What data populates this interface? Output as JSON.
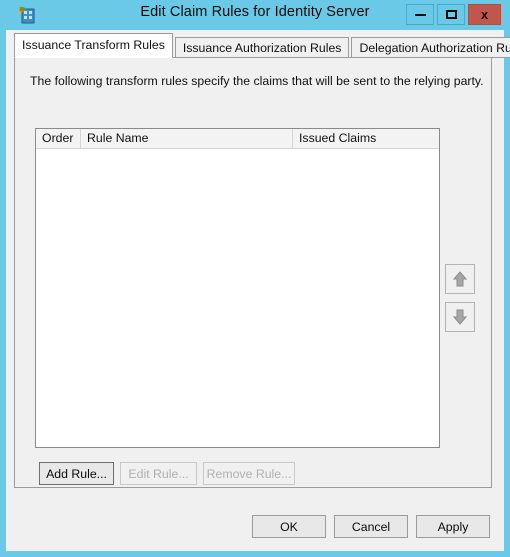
{
  "window": {
    "title": "Edit Claim Rules for Identity Server",
    "icon": "server-app-icon",
    "frame_color": "#6BC9E8",
    "close_color": "#C1564B",
    "controls": {
      "minimize_label": "—",
      "maximize_label": "□",
      "close_label": "x"
    }
  },
  "tabs": [
    {
      "label": "Issuance Transform Rules",
      "active": true
    },
    {
      "label": "Issuance Authorization Rules",
      "active": false
    },
    {
      "label": "Delegation Authorization Rules",
      "active": false
    }
  ],
  "panel": {
    "description": "The following transform rules specify the claims that will be sent to the relying party."
  },
  "list": {
    "columns": [
      "Order",
      "Rule Name",
      "Issued Claims"
    ],
    "rows": []
  },
  "order_buttons": {
    "move_up": "move-up-arrow",
    "move_down": "move-down-arrow"
  },
  "rule_buttons": [
    {
      "label": "Add Rule...",
      "enabled": true
    },
    {
      "label": "Edit Rule...",
      "enabled": false
    },
    {
      "label": "Remove Rule...",
      "enabled": false
    }
  ],
  "dialog_buttons": [
    {
      "label": "OK"
    },
    {
      "label": "Cancel"
    },
    {
      "label": "Apply"
    }
  ]
}
